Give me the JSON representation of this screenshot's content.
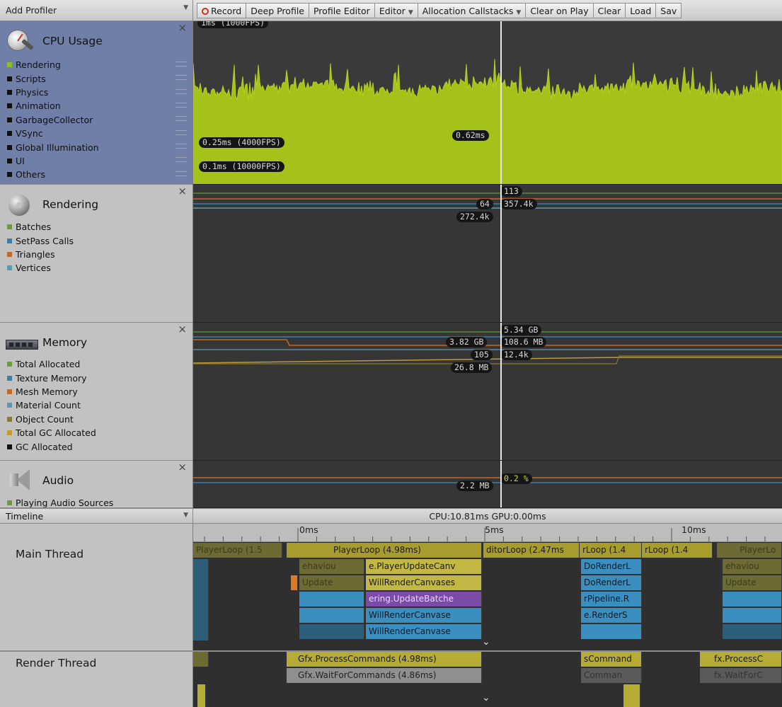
{
  "toolbar": {
    "add_profiler": "Add Profiler",
    "record": "Record",
    "deep_profile": "Deep Profile",
    "profile_editor": "Profile Editor",
    "editor": "Editor",
    "allocation_callstacks": "Allocation Callstacks",
    "clear_on_play": "Clear on Play",
    "clear": "Clear",
    "load": "Load",
    "save": "Sav"
  },
  "cpu": {
    "title": "CPU Usage",
    "legend": [
      "Rendering",
      "Scripts",
      "Physics",
      "Animation",
      "GarbageCollector",
      "VSync",
      "Global Illumination",
      "UI",
      "Others"
    ],
    "colors": {
      "rendering": "#8bbd2c",
      "fill": "#a4c21a",
      "other": "#111111"
    },
    "guide_top": "1ms (1000FPS)",
    "guide_mid": "0.25ms (4000FPS)",
    "guide_low": "0.1ms (10000FPS)",
    "selected_value": "0.62ms"
  },
  "rendering": {
    "title": "Rendering",
    "legend": [
      "Batches",
      "SetPass Calls",
      "Triangles",
      "Vertices"
    ],
    "colors": [
      "#6d9a3a",
      "#3b7fa8",
      "#c06a2a",
      "#5a9ab0"
    ],
    "values": {
      "batches": "113",
      "setpass": "64",
      "triangles": "357.4k",
      "vertices": "272.4k"
    }
  },
  "memory": {
    "title": "Memory",
    "legend": [
      "Total Allocated",
      "Texture Memory",
      "Mesh Memory",
      "Material Count",
      "Object Count",
      "Total GC Allocated",
      "GC Allocated"
    ],
    "colors": [
      "#6d9a3a",
      "#3b7fa8",
      "#c06a2a",
      "#5a9ab0",
      "#8a7a30",
      "#c09a3a",
      "#111111"
    ],
    "values": {
      "total_allocated": "5.34 GB",
      "texture": "3.82 GB",
      "mesh": "108.6 MB",
      "material": "105",
      "object": "12.4k",
      "gc": "26.8 MB"
    }
  },
  "audio": {
    "title": "Audio",
    "legend": [
      "Playing Audio Sources"
    ],
    "values": {
      "memory": "2.2 MB",
      "cpu": "0.2 %"
    }
  },
  "timeline": {
    "label": "Timeline",
    "summary": "CPU:10.81ms  GPU:0.00ms",
    "ticks": [
      "0ms",
      "5ms",
      "10ms"
    ],
    "threads": [
      "Main Thread",
      "Render Thread"
    ],
    "main_blocks": {
      "player_loop": "PlayerLoop (4.98ms)",
      "player_loop_prev": "PlayerLoop (1.5",
      "editor_loop": "ditorLoop (2.47ms",
      "loop_a": "rLoop (1.4",
      "loop_b": "rLoop (1.4",
      "player_loop_next": "PlayerLo",
      "behaviour": "ehaviou",
      "player_update_canvas": "e.PlayerUpdateCanv",
      "update": "Update",
      "will_render_canvases_1": "WillRenderCanvases",
      "update_batches": "ering.UpdateBatche",
      "will_render_canvases_2": "WillRenderCanvase",
      "will_render_canvases_3": "WillRenderCanvase",
      "do_render_1": "DoRenderL",
      "do_render_2": "DoRenderL",
      "pipeline": "rPipeline.R",
      "render_s": "e.RenderS",
      "behaviour_next": "ehaviou",
      "update_next": "Update"
    },
    "render_blocks": {
      "process_commands": "Gfx.ProcessCommands (4.98ms)",
      "wait_commands": "Gfx.WaitForCommands (4.86ms)",
      "s_command": "sCommand",
      "comman": "Comman",
      "process_next": "fx.ProcessC",
      "wait_next": "fx.WaitForC"
    }
  }
}
